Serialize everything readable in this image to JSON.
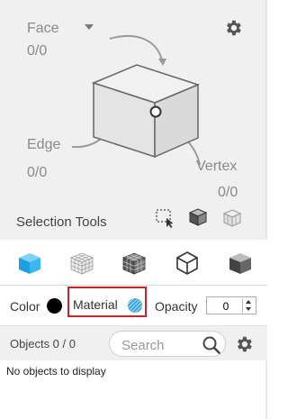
{
  "selection_panel": {
    "face_label": "Face",
    "face_count": "0/0",
    "edge_label": "Edge",
    "edge_count": "0/0",
    "vertex_label": "Vertex",
    "vertex_count": "0/0",
    "tools_label": "Selection Tools",
    "settings_icon": "gear-icon",
    "dropdown_icon": "caret-down-icon"
  },
  "view_toolbar": {
    "icons": [
      "solid-cube-icon",
      "wireframe-grid-cube-icon",
      "shaded-grid-cube-icon",
      "outline-cube-icon",
      "half-shaded-cube-icon"
    ]
  },
  "properties": {
    "color_label": "Color",
    "color_value": "#000000",
    "material_label": "Material",
    "opacity_label": "Opacity",
    "opacity_value": "0"
  },
  "objects": {
    "label": "Objects 0 / 0",
    "search_placeholder": "Search",
    "empty_message": "No objects to display"
  },
  "colors": {
    "highlight": "#d0202a",
    "accent_blue": "#1ea0e0"
  }
}
